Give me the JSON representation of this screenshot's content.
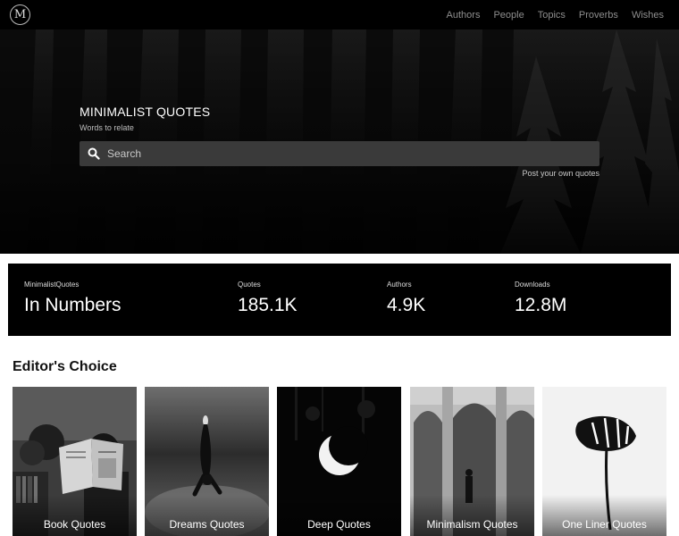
{
  "nav": {
    "logo": "M",
    "links": [
      "Authors",
      "People",
      "Topics",
      "Proverbs",
      "Wishes"
    ]
  },
  "hero": {
    "title": "MINIMALIST QUOTES",
    "subtitle": "Words to relate",
    "search_placeholder": "Search",
    "post_link": "Post your own quotes"
  },
  "stats": {
    "brand_label": "MinimalistQuotes",
    "brand_value": "In Numbers",
    "items": [
      {
        "label": "Quotes",
        "value": "185.1K"
      },
      {
        "label": "Authors",
        "value": "4.9K"
      },
      {
        "label": "Downloads",
        "value": "12.8M"
      }
    ]
  },
  "editors_choice": {
    "title": "Editor's Choice",
    "cards": [
      {
        "label": "Book Quotes",
        "image": "person-reading-book"
      },
      {
        "label": "Dreams Quotes",
        "image": "diver-underwater"
      },
      {
        "label": "Deep Quotes",
        "image": "crescent-moon"
      },
      {
        "label": "Minimalism Quotes",
        "image": "arches-architecture"
      },
      {
        "label": "One Liner Quotes",
        "image": "monstera-leaf"
      }
    ]
  }
}
